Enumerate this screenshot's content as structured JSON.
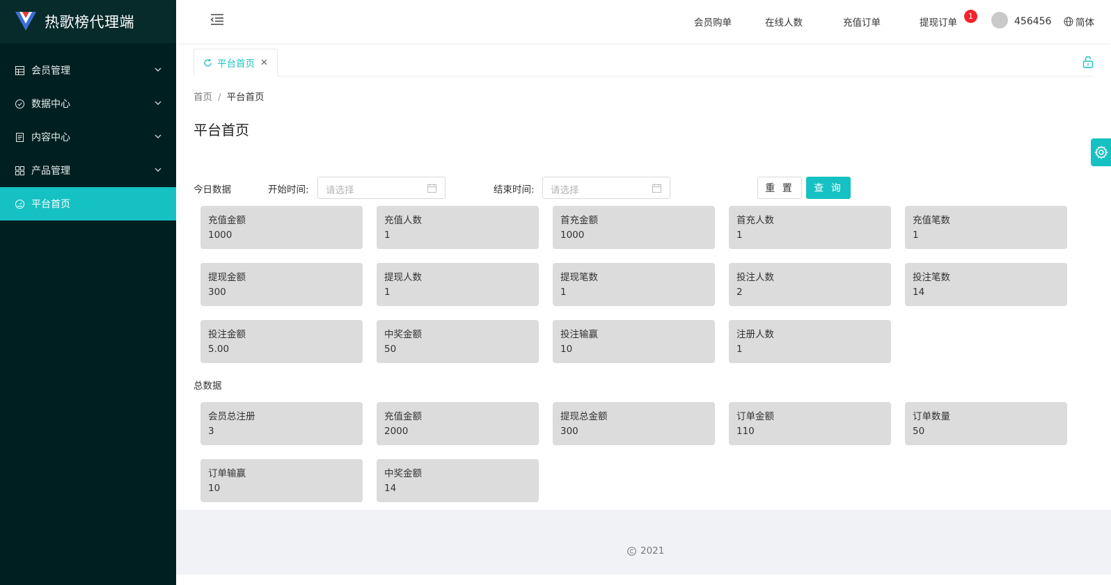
{
  "app": {
    "title": "热歌榜代理端"
  },
  "colors": {
    "accent": "#16c1c3",
    "sidebar_bg": "#001f21",
    "card_bg": "#dcdcdc",
    "badge": "#f5222d"
  },
  "sidebar": {
    "items": [
      {
        "label": "会员管理",
        "icon": "table-icon",
        "expandable": true
      },
      {
        "label": "数据中心",
        "icon": "check-circle-icon",
        "expandable": true
      },
      {
        "label": "内容中心",
        "icon": "document-icon",
        "expandable": true
      },
      {
        "label": "产品管理",
        "icon": "grid-icon",
        "expandable": true
      },
      {
        "label": "平台首页",
        "icon": "dashboard-icon",
        "expandable": false,
        "active": true
      }
    ]
  },
  "header": {
    "nav": [
      {
        "label": "会员购单"
      },
      {
        "label": "在线人数"
      },
      {
        "label": "充值订单"
      },
      {
        "label": "提现订单",
        "badge": "1"
      }
    ],
    "username": "456456",
    "language": "简体"
  },
  "tabs": [
    {
      "label": "平台首页",
      "icon": "refresh-icon",
      "closable": true
    }
  ],
  "breadcrumb": {
    "home": "首页",
    "separator": "/",
    "current": "平台首页"
  },
  "page": {
    "title": "平台首页"
  },
  "filters": {
    "today_label": "今日数据",
    "start_label": "开始时间:",
    "start_placeholder": "请选择",
    "end_label": "结束时间:",
    "end_placeholder": "请选择",
    "reset_label": "重 置",
    "query_label": "查 询"
  },
  "today_stats": [
    {
      "label": "充值金额",
      "value": "1000"
    },
    {
      "label": "充值人数",
      "value": "1"
    },
    {
      "label": "首充金额",
      "value": "1000"
    },
    {
      "label": "首充人数",
      "value": "1"
    },
    {
      "label": "充值笔数",
      "value": "1"
    },
    {
      "label": "提现金额",
      "value": "300"
    },
    {
      "label": "提现人数",
      "value": "1"
    },
    {
      "label": "提现笔数",
      "value": "1"
    },
    {
      "label": "投注人数",
      "value": "2"
    },
    {
      "label": "投注笔数",
      "value": "14"
    },
    {
      "label": "投注金额",
      "value": "5.00"
    },
    {
      "label": "中奖金额",
      "value": "50"
    },
    {
      "label": "投注输赢",
      "value": "10"
    },
    {
      "label": "注册人数",
      "value": "1"
    }
  ],
  "total_label": "总数据",
  "total_stats": [
    {
      "label": "会员总注册",
      "value": "3"
    },
    {
      "label": "充值金额",
      "value": "2000"
    },
    {
      "label": "提现总金额",
      "value": "300"
    },
    {
      "label": "订单金额",
      "value": "110"
    },
    {
      "label": "订单数量",
      "value": "50"
    },
    {
      "label": "订单输赢",
      "value": "10"
    },
    {
      "label": "中奖金额",
      "value": "14"
    }
  ],
  "footer": {
    "text": "2021"
  }
}
